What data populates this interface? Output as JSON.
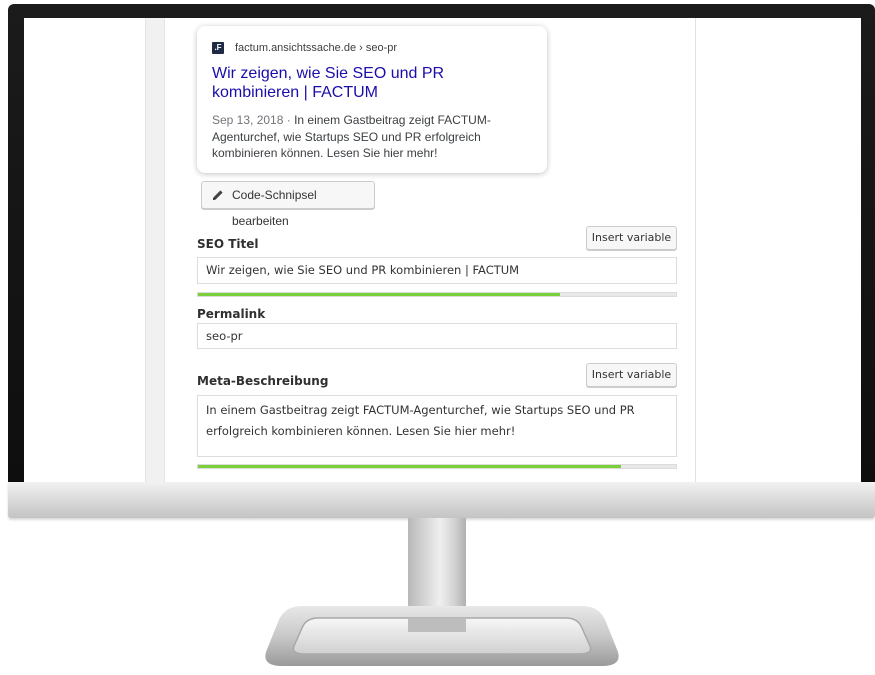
{
  "snippet": {
    "favicon_letter": ".F",
    "url": "factum.ansichtssache.de › seo-pr",
    "title": "Wir zeigen, wie Sie SEO und PR kombinieren | FACTUM",
    "date": "Sep 13, 2018",
    "separator": " · ",
    "description": "In einem Gastbeitrag zeigt FACTUM-Agenturchef, wie Startups SEO und PR erfolgreich kombinieren können. Lesen Sie hier mehr!"
  },
  "edit_snippet_label": "Code-Schnipsel bearbeiten",
  "seo_title": {
    "label": "SEO Titel",
    "insert_label": "Insert variable",
    "value": "Wir zeigen, wie Sie SEO und PR kombinieren | FACTUM",
    "progress": 0.757
  },
  "permalink": {
    "label": "Permalink",
    "value": "seo-pr"
  },
  "meta_description": {
    "label": "Meta-Beschreibung",
    "insert_label": "Insert variable",
    "value": "In einem Gastbeitrag zeigt FACTUM-Agenturchef, wie Startups SEO und PR erfolgreich kombinieren können. Lesen Sie hier mehr!",
    "progress": 0.885
  },
  "colors": {
    "progress_good": "#7ad03a",
    "link": "#1a0dab"
  }
}
